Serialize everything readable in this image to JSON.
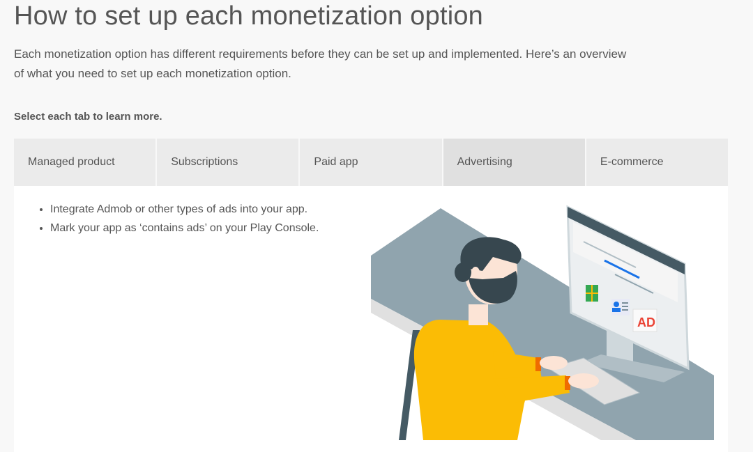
{
  "page": {
    "title": "How to set up each monetization option",
    "intro": "Each monetization option has different requirements before they can be set up and implemented. Here’s an overview of what you need to set up each monetization option.",
    "prompt": "Select each tab to learn more."
  },
  "tabs": [
    {
      "label": "Managed product"
    },
    {
      "label": "Subscriptions"
    },
    {
      "label": "Paid app"
    },
    {
      "label": "Advertising",
      "active": true
    },
    {
      "label": "E-commerce"
    }
  ],
  "panel": {
    "bullets": [
      "Integrate Admob or other types of ads into your app.",
      "Mark your app as ‘contains ads’ on your Play Console."
    ],
    "illustration": {
      "ad_label": "AD",
      "icon": "person-at-computer-illustration"
    }
  },
  "colors": {
    "background": "#f8f8f8",
    "tab": "#ebebeb",
    "tab_active": "#e0e0e0",
    "sweater": "#fbbc05",
    "desk": "#90a4ae",
    "ad_red": "#ea4335"
  }
}
